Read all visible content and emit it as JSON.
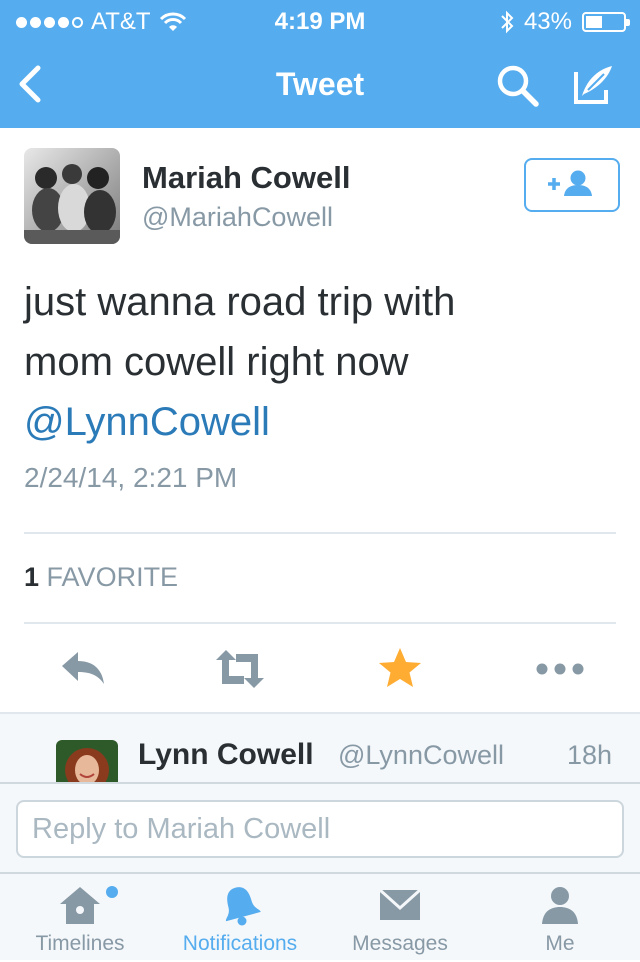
{
  "status_bar": {
    "carrier": "AT&T",
    "time": "4:19 PM",
    "battery": "43%"
  },
  "nav": {
    "title": "Tweet"
  },
  "tweet": {
    "author_name": "Mariah Cowell",
    "author_handle": "@MariahCowell",
    "text_line1": "just wanna road trip with",
    "text_line2": "mom cowell right now",
    "mention": "@LynnCowell",
    "timestamp": "2/24/14, 2:21 PM",
    "favorite_count": "1",
    "favorite_label": "FAVORITE"
  },
  "reply_preview": {
    "name": "Lynn Cowell",
    "handle": "@LynnCowell",
    "time": "18h"
  },
  "reply_box": {
    "placeholder": "Reply to Mariah Cowell"
  },
  "tabs": [
    {
      "label": "Timelines",
      "icon": "home-icon"
    },
    {
      "label": "Notifications",
      "icon": "bell-icon"
    },
    {
      "label": "Messages",
      "icon": "envelope-icon"
    },
    {
      "label": "Me",
      "icon": "person-icon"
    }
  ],
  "colors": {
    "brand": "#55acee",
    "link": "#2b7bb9",
    "favorite": "#ffac33",
    "muted": "#8899a6",
    "text": "#292f33"
  }
}
